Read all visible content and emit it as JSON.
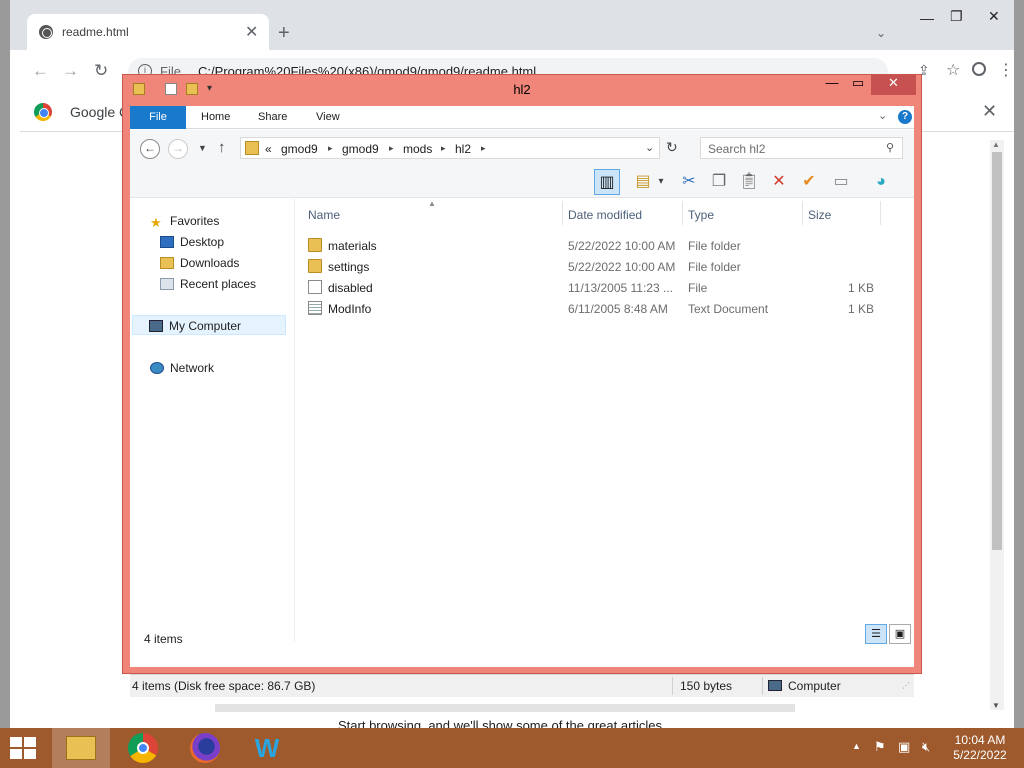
{
  "chrome": {
    "tab_title": "readme.html",
    "new_tab": "+",
    "url_scheme": "File",
    "url": "C:/Program%20Files%20(x86)/gmod9/gmod9/readme.html",
    "infobar_text": "Google C",
    "footer_text": "Start browsing, and we'll show some of the great articles"
  },
  "explorer": {
    "window_title": "hl2",
    "ribbon_tabs": [
      "File",
      "Home",
      "Share",
      "View"
    ],
    "breadcrumb": {
      "overflow": "«",
      "items": [
        "gmod9",
        "gmod9",
        "mods",
        "hl2"
      ]
    },
    "search_placeholder": "Search hl2",
    "nav": {
      "favorites": "Favorites",
      "desktop": "Desktop",
      "downloads": "Downloads",
      "recent": "Recent places",
      "my_computer": "My Computer",
      "network": "Network"
    },
    "columns": {
      "name": "Name",
      "date": "Date modified",
      "type": "Type",
      "size": "Size"
    },
    "files": [
      {
        "name": "materials",
        "date": "5/22/2022 10:00 AM",
        "type": "File folder",
        "size": "",
        "icon": "folder-icon"
      },
      {
        "name": "settings",
        "date": "5/22/2022 10:00 AM",
        "type": "File folder",
        "size": "",
        "icon": "folder-icon"
      },
      {
        "name": "disabled",
        "date": "11/13/2005 11:23 ...",
        "type": "File",
        "size": "1 KB",
        "icon": "file-icon"
      },
      {
        "name": "ModInfo",
        "date": "6/11/2005 8:48 AM",
        "type": "Text Document",
        "size": "1 KB",
        "icon": "text-document-icon"
      }
    ],
    "item_count": "4 items",
    "status": {
      "left": "4 items (Disk free space: 86.7 GB)",
      "size": "150 bytes",
      "location": "Computer"
    }
  },
  "taskbar": {
    "time": "10:04 AM",
    "date": "5/22/2022"
  },
  "colors": {
    "explorer_frame": "#f0857a",
    "close_button": "#c75050",
    "ribbon_file": "#1979ca",
    "taskbar": "#9e5a2d"
  }
}
